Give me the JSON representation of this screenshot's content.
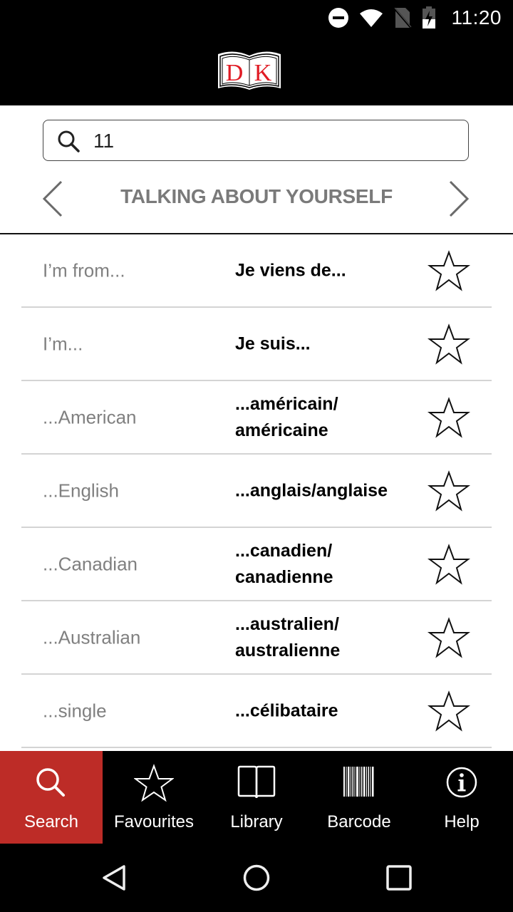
{
  "status_bar": {
    "time": "11:20",
    "icons": [
      "do-not-disturb-icon",
      "wifi-icon",
      "no-sim-icon",
      "battery-charging-icon"
    ]
  },
  "app_bar": {
    "logo_text": "DK",
    "logo_color": "#e01b24"
  },
  "search": {
    "value": "11",
    "placeholder": ""
  },
  "section": {
    "title": "TALKING ABOUT YOURSELF",
    "prev_icon": "chevron-left-icon",
    "next_icon": "chevron-right-icon"
  },
  "phrases": [
    {
      "english": "I’m from...",
      "french": "Je viens de...",
      "favourite": false
    },
    {
      "english": "I’m...",
      "french": "Je suis...",
      "favourite": false
    },
    {
      "english": "...American",
      "french": "...américain/ américaine",
      "favourite": false
    },
    {
      "english": "...English",
      "french": "...anglais/anglaise",
      "favourite": false
    },
    {
      "english": "...Canadian",
      "french": "...canadien/ canadienne",
      "favourite": false
    },
    {
      "english": "...Australian",
      "french": "...australien/ australienne",
      "favourite": false
    },
    {
      "english": "...single",
      "french": "...célibataire",
      "favourite": false
    }
  ],
  "tabs": [
    {
      "label": "Search",
      "icon": "search-icon",
      "active": true
    },
    {
      "label": "Favourites",
      "icon": "star-icon",
      "active": false
    },
    {
      "label": "Library",
      "icon": "book-icon",
      "active": false
    },
    {
      "label": "Barcode",
      "icon": "barcode-icon",
      "active": false
    },
    {
      "label": "Help",
      "icon": "info-icon",
      "active": false
    }
  ],
  "colors": {
    "accent": "#bd2c27",
    "section_title": "#7a7a7a",
    "english_text": "#808080"
  },
  "system_nav": [
    "back-icon",
    "home-icon",
    "recents-icon"
  ]
}
